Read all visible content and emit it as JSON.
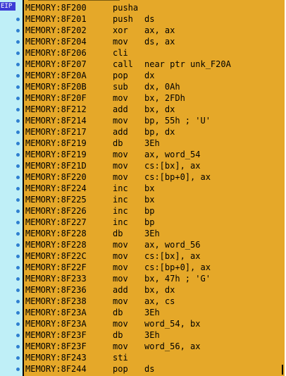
{
  "gutter": {
    "eip_label": "EIP"
  },
  "rows": [
    {
      "addr": "MEMORY:8F200",
      "mn": "pusha",
      "op": ""
    },
    {
      "addr": "MEMORY:8F201",
      "mn": "push",
      "op": "ds"
    },
    {
      "addr": "MEMORY:8F202",
      "mn": "xor",
      "op": "ax, ax"
    },
    {
      "addr": "MEMORY:8F204",
      "mn": "mov",
      "op": "ds, ax"
    },
    {
      "addr": "MEMORY:8F206",
      "mn": "cli",
      "op": ""
    },
    {
      "addr": "MEMORY:8F207",
      "mn": "call",
      "op": "near ptr unk_F20A"
    },
    {
      "addr": "MEMORY:8F20A",
      "mn": "pop",
      "op": "dx"
    },
    {
      "addr": "MEMORY:8F20B",
      "mn": "sub",
      "op": "dx, 0Ah"
    },
    {
      "addr": "MEMORY:8F20F",
      "mn": "mov",
      "op": "bx, 2FDh"
    },
    {
      "addr": "MEMORY:8F212",
      "mn": "add",
      "op": "bx, dx"
    },
    {
      "addr": "MEMORY:8F214",
      "mn": "mov",
      "op": "bp, 55h ; 'U'"
    },
    {
      "addr": "MEMORY:8F217",
      "mn": "add",
      "op": "bp, dx"
    },
    {
      "addr": "MEMORY:8F219",
      "mn": "db",
      "op": "3Eh"
    },
    {
      "addr": "MEMORY:8F219",
      "mn": "mov",
      "op": "ax, word_54"
    },
    {
      "addr": "MEMORY:8F21D",
      "mn": "mov",
      "op": "cs:[bx], ax"
    },
    {
      "addr": "MEMORY:8F220",
      "mn": "mov",
      "op": "cs:[bp+0], ax"
    },
    {
      "addr": "MEMORY:8F224",
      "mn": "inc",
      "op": "bx"
    },
    {
      "addr": "MEMORY:8F225",
      "mn": "inc",
      "op": "bx"
    },
    {
      "addr": "MEMORY:8F226",
      "mn": "inc",
      "op": "bp"
    },
    {
      "addr": "MEMORY:8F227",
      "mn": "inc",
      "op": "bp"
    },
    {
      "addr": "MEMORY:8F228",
      "mn": "db",
      "op": "3Eh"
    },
    {
      "addr": "MEMORY:8F228",
      "mn": "mov",
      "op": "ax, word_56"
    },
    {
      "addr": "MEMORY:8F22C",
      "mn": "mov",
      "op": "cs:[bx], ax"
    },
    {
      "addr": "MEMORY:8F22F",
      "mn": "mov",
      "op": "cs:[bp+0], ax"
    },
    {
      "addr": "MEMORY:8F233",
      "mn": "mov",
      "op": "bx, 47h ; 'G'"
    },
    {
      "addr": "MEMORY:8F236",
      "mn": "add",
      "op": "bx, dx"
    },
    {
      "addr": "MEMORY:8F238",
      "mn": "mov",
      "op": "ax, cs"
    },
    {
      "addr": "MEMORY:8F23A",
      "mn": "db",
      "op": "3Eh"
    },
    {
      "addr": "MEMORY:8F23A",
      "mn": "mov",
      "op": "word_54, bx"
    },
    {
      "addr": "MEMORY:8F23F",
      "mn": "db",
      "op": "3Eh"
    },
    {
      "addr": "MEMORY:8F23F",
      "mn": "mov",
      "op": "word_56, ax"
    },
    {
      "addr": "MEMORY:8F243",
      "mn": "sti",
      "op": ""
    },
    {
      "addr": "MEMORY:8F244",
      "mn": "pop",
      "op": "ds"
    }
  ],
  "colors": {
    "listing_bg": "#e5a829",
    "gutter_bg": "#bfeff7",
    "eip_bg": "#3c3cd6",
    "breakpoint_dot": "#2f7fd0"
  }
}
